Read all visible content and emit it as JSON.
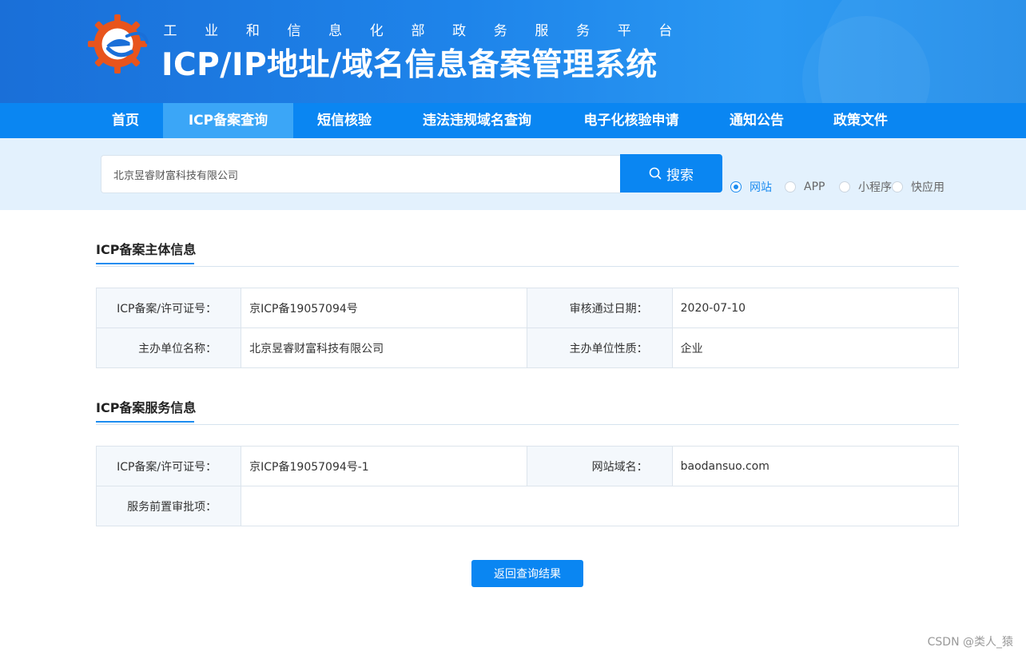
{
  "header": {
    "subtitle_chars": [
      "工",
      "业",
      "和",
      "信",
      "息",
      "化",
      "部",
      "政",
      "务",
      "服",
      "务",
      "平",
      "台"
    ],
    "title": "ICP/IP地址/域名信息备案管理系统",
    "logo_icon": "gear-e-logo-icon"
  },
  "nav": {
    "items": [
      {
        "label": "首页",
        "active": false
      },
      {
        "label": "ICP备案查询",
        "active": true
      },
      {
        "label": "短信核验",
        "active": false
      },
      {
        "label": "违法违规域名查询",
        "active": false
      },
      {
        "label": "电子化核验申请",
        "active": false
      },
      {
        "label": "通知公告",
        "active": false
      },
      {
        "label": "政策文件",
        "active": false
      }
    ]
  },
  "search": {
    "value": "北京昱睿财富科技有限公司",
    "button_label": "搜索",
    "button_icon": "search-icon",
    "types": [
      {
        "label": "网站",
        "checked": true
      },
      {
        "label": "APP",
        "checked": false
      },
      {
        "label": "小程序",
        "checked": false
      },
      {
        "label": "快应用",
        "checked": false
      }
    ]
  },
  "subject": {
    "title": "ICP备案主体信息",
    "license_label": "ICP备案/许可证号：",
    "license_value": "京ICP备19057094号",
    "approve_date_label": "审核通过日期：",
    "approve_date_value": "2020-07-10",
    "org_name_label": "主办单位名称：",
    "org_name_value": "北京昱睿财富科技有限公司",
    "org_type_label": "主办单位性质：",
    "org_type_value": "企业"
  },
  "service": {
    "title": "ICP备案服务信息",
    "license_label": "ICP备案/许可证号：",
    "license_value": "京ICP备19057094号-1",
    "domain_label": "网站域名：",
    "domain_value": "baodansuo.com",
    "pre_approval_label": "服务前置审批项：",
    "pre_approval_value": ""
  },
  "back_button_label": "返回查询结果",
  "watermark": "CSDN @类人_猿",
  "colors": {
    "primary": "#0a86f2",
    "nav_active": "#3ba6f7",
    "search_bg": "#e3f1fd",
    "logo_orange": "#e8541c"
  }
}
